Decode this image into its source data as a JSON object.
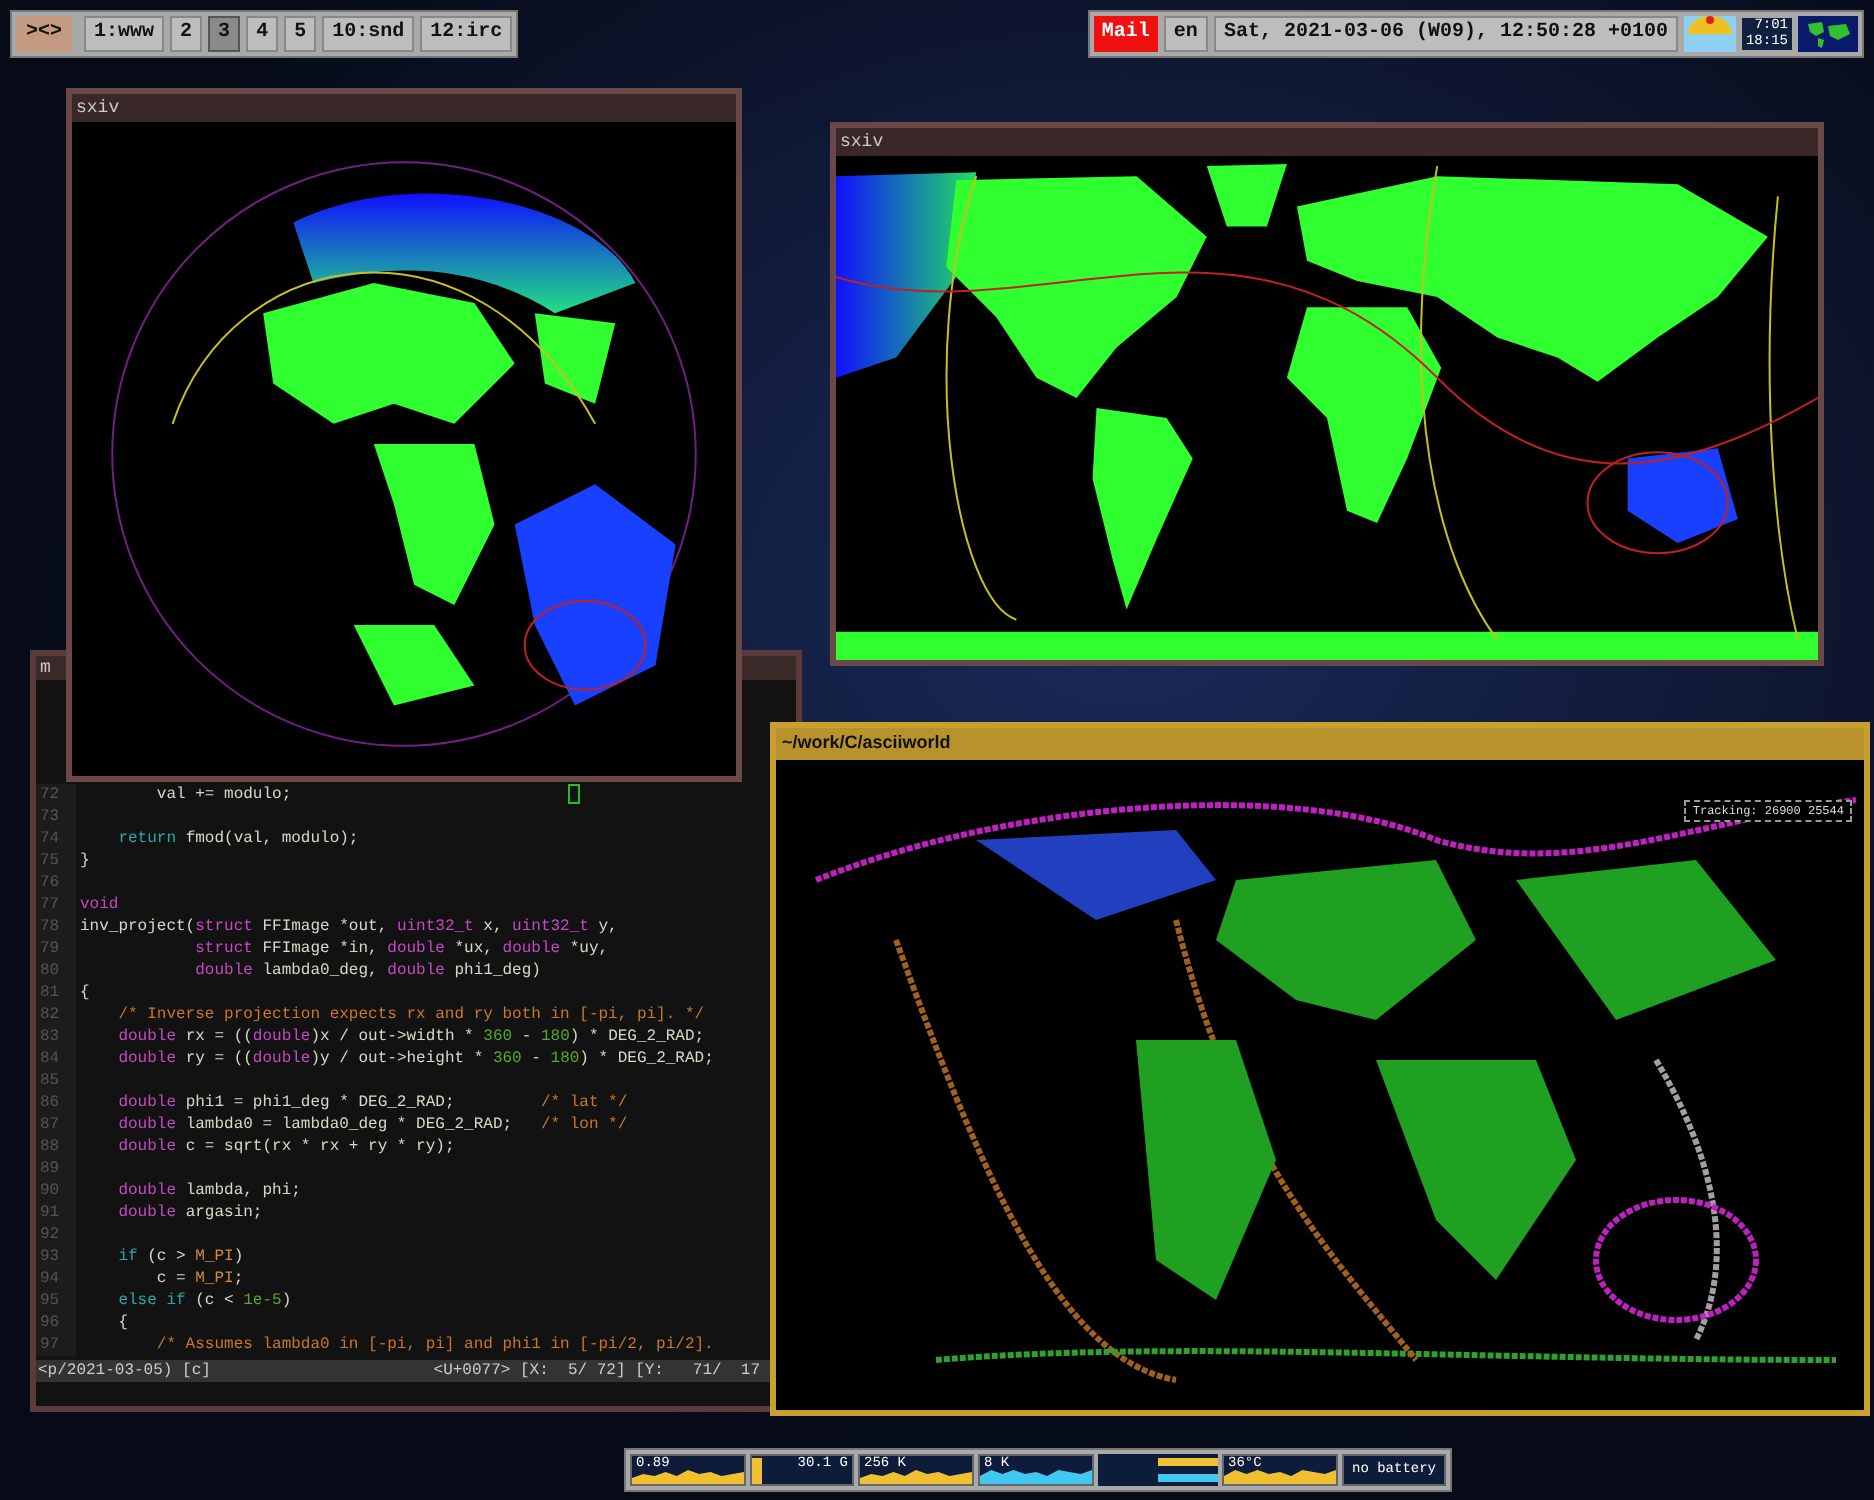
{
  "top_bar": {
    "layout_symbol": "><>",
    "tags": [
      {
        "label": "1:www",
        "selected": false
      },
      {
        "label": "2",
        "selected": false
      },
      {
        "label": "3",
        "selected": true
      },
      {
        "label": "4",
        "selected": false
      },
      {
        "label": "5",
        "selected": false
      },
      {
        "label": "10:snd",
        "selected": false
      },
      {
        "label": "12:irc",
        "selected": false
      }
    ],
    "mail": "Mail",
    "keyboard": "en",
    "clock": "Sat, 2021-03-06 (W09), 12:50:28 +0100",
    "sunrise": "7:01",
    "sunset": "18:15"
  },
  "image_viewer_left": {
    "title": "sxiv"
  },
  "image_viewer_right": {
    "title": "sxiv"
  },
  "editor": {
    "title": "m",
    "lines": [
      {
        "number": "72",
        "tokens": [
          {
            "kind": "plain",
            "text": "        val += modulo;"
          }
        ]
      },
      {
        "number": "73"
      },
      {
        "number": "74",
        "tokens": [
          {
            "kind": "control",
            "text": "    return"
          },
          {
            "kind": "plain",
            "text": " fmod(val, modulo);"
          }
        ]
      },
      {
        "number": "75",
        "tokens": [
          {
            "kind": "plain",
            "text": "}"
          }
        ]
      },
      {
        "number": "76"
      },
      {
        "number": "77",
        "tokens": [
          {
            "kind": "type",
            "text": "void"
          }
        ]
      },
      {
        "number": "78",
        "tokens": [
          {
            "kind": "plain",
            "text": "inv_project("
          },
          {
            "kind": "type",
            "text": "struct"
          },
          {
            "kind": "plain",
            "text": " FFImage *out, "
          },
          {
            "kind": "type",
            "text": "uint32_t"
          },
          {
            "kind": "plain",
            "text": " x, "
          },
          {
            "kind": "type",
            "text": "uint32_t"
          },
          {
            "kind": "plain",
            "text": " y,"
          }
        ]
      },
      {
        "number": "79",
        "tokens": [
          {
            "kind": "type",
            "text": "            struct"
          },
          {
            "kind": "plain",
            "text": " FFImage *in, "
          },
          {
            "kind": "type",
            "text": "double"
          },
          {
            "kind": "plain",
            "text": " *ux, "
          },
          {
            "kind": "type",
            "text": "double"
          },
          {
            "kind": "plain",
            "text": " *uy,"
          }
        ]
      },
      {
        "number": "80",
        "tokens": [
          {
            "kind": "type",
            "text": "            double"
          },
          {
            "kind": "plain",
            "text": " lambda0_deg, "
          },
          {
            "kind": "type",
            "text": "double"
          },
          {
            "kind": "plain",
            "text": " phi1_deg)"
          }
        ]
      },
      {
        "number": "81",
        "tokens": [
          {
            "kind": "plain",
            "text": "{"
          }
        ]
      },
      {
        "number": "82",
        "tokens": [
          {
            "kind": "comment",
            "text": "    /* Inverse projection expects rx and ry both in [-pi, pi]. */"
          }
        ]
      },
      {
        "number": "83",
        "tokens": [
          {
            "kind": "type",
            "text": "    double"
          },
          {
            "kind": "plain",
            "text": " rx = (("
          },
          {
            "kind": "type",
            "text": "double"
          },
          {
            "kind": "plain",
            "text": ")x / out->width * "
          },
          {
            "kind": "number",
            "text": "360"
          },
          {
            "kind": "plain",
            "text": " - "
          },
          {
            "kind": "number",
            "text": "180"
          },
          {
            "kind": "plain",
            "text": ") * DEG_2_RAD;"
          }
        ]
      },
      {
        "number": "84",
        "tokens": [
          {
            "kind": "type",
            "text": "    double"
          },
          {
            "kind": "plain",
            "text": " ry = (("
          },
          {
            "kind": "type",
            "text": "double"
          },
          {
            "kind": "plain",
            "text": ")y / out->height * "
          },
          {
            "kind": "number",
            "text": "360"
          },
          {
            "kind": "plain",
            "text": " - "
          },
          {
            "kind": "number",
            "text": "180"
          },
          {
            "kind": "plain",
            "text": ") * DEG_2_RAD;"
          }
        ]
      },
      {
        "number": "85"
      },
      {
        "number": "86",
        "tokens": [
          {
            "kind": "type",
            "text": "    double"
          },
          {
            "kind": "plain",
            "text": " phi1 = phi1_deg * DEG_2_RAD;         "
          },
          {
            "kind": "comment",
            "text": "/* lat */"
          }
        ]
      },
      {
        "number": "87",
        "tokens": [
          {
            "kind": "type",
            "text": "    double"
          },
          {
            "kind": "plain",
            "text": " lambda0 = lambda0_deg * DEG_2_RAD;   "
          },
          {
            "kind": "comment",
            "text": "/* lon */"
          }
        ]
      },
      {
        "number": "88",
        "tokens": [
          {
            "kind": "type",
            "text": "    double"
          },
          {
            "kind": "plain",
            "text": " c = sqrt(rx * rx + ry * ry);"
          }
        ]
      },
      {
        "number": "89"
      },
      {
        "number": "90",
        "tokens": [
          {
            "kind": "type",
            "text": "    double"
          },
          {
            "kind": "plain",
            "text": " lambda, phi;"
          }
        ]
      },
      {
        "number": "91",
        "tokens": [
          {
            "kind": "type",
            "text": "    double"
          },
          {
            "kind": "plain",
            "text": " argasin;"
          }
        ]
      },
      {
        "number": "92"
      },
      {
        "number": "93",
        "tokens": [
          {
            "kind": "control",
            "text": "    if"
          },
          {
            "kind": "plain",
            "text": " (c > "
          },
          {
            "kind": "constant",
            "text": "M_PI"
          },
          {
            "kind": "plain",
            "text": ")"
          }
        ]
      },
      {
        "number": "94",
        "tokens": [
          {
            "kind": "plain",
            "text": "        c = "
          },
          {
            "kind": "constant",
            "text": "M_PI"
          },
          {
            "kind": "plain",
            "text": ";"
          }
        ]
      },
      {
        "number": "95",
        "tokens": [
          {
            "kind": "control",
            "text": "    else if"
          },
          {
            "kind": "plain",
            "text": " (c < "
          },
          {
            "kind": "number",
            "text": "1e-5"
          },
          {
            "kind": "plain",
            "text": ")"
          }
        ]
      },
      {
        "number": "96",
        "tokens": [
          {
            "kind": "plain",
            "text": "    {"
          }
        ]
      },
      {
        "number": "97",
        "tokens": [
          {
            "kind": "comment",
            "text": "        /* Assumes lambda0 in [-pi, pi] and phi1 in [-pi/2, pi/2]."
          }
        ]
      }
    ],
    "status_left": "<p/2021-03-05) [c]",
    "status_right": "<U+0077> [X:  5/ 72] [Y:   71/  17"
  },
  "terminal": {
    "title": "~/work/C/asciiworld",
    "tracking": "Tracking: 26900 25544"
  },
  "status_widgets": [
    {
      "kind": "graph",
      "label": "0.89",
      "color": "#f0c030"
    },
    {
      "kind": "meter",
      "label": "30.1 G",
      "level": 0.95
    },
    {
      "kind": "graph",
      "label": "256 K",
      "color": "#f0c030"
    },
    {
      "kind": "graph",
      "label": "8 K",
      "color": "#40c8f0"
    },
    {
      "kind": "bars"
    },
    {
      "kind": "graph",
      "label": "36°C",
      "color": "#f0c030"
    },
    {
      "kind": "text",
      "label": "no battery"
    }
  ]
}
